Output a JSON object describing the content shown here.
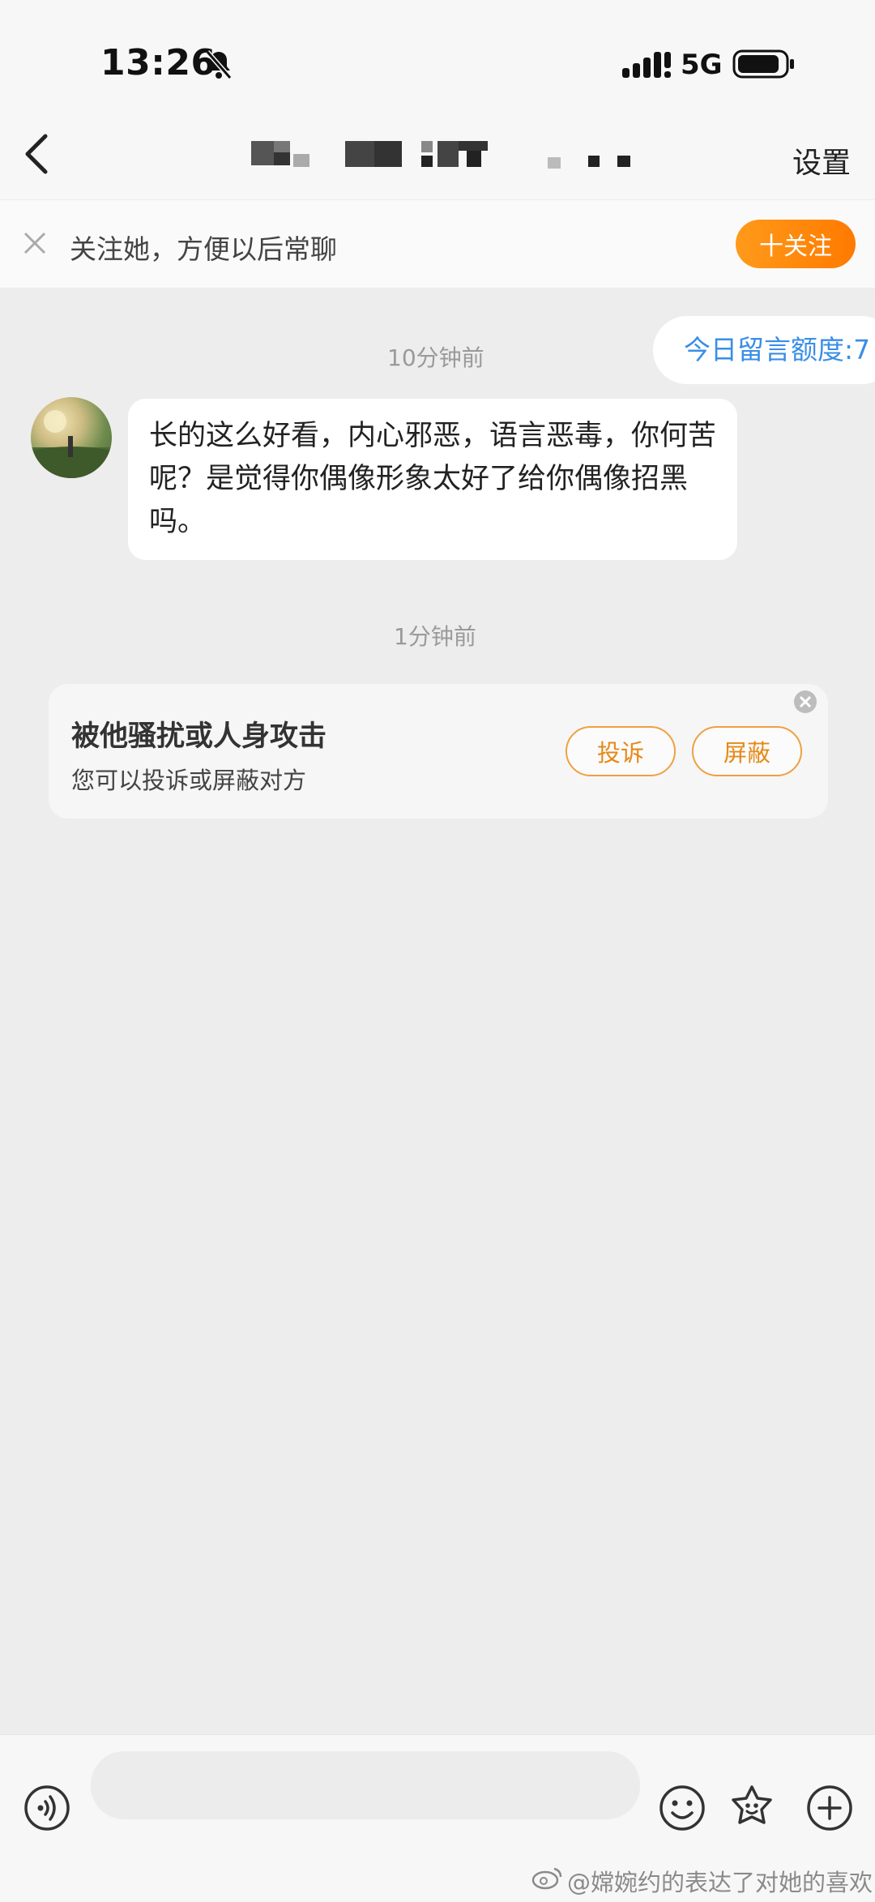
{
  "status_bar": {
    "time": "13:26",
    "network": "5G",
    "icons": [
      "bell-muted-icon",
      "signal-icon",
      "battery-icon"
    ]
  },
  "header": {
    "title": "",
    "settings_label": "设置"
  },
  "follow_banner": {
    "text": "关注她，方便以后常聊",
    "button_label": "十关注"
  },
  "chat": {
    "quota_text": "今日留言额度:7",
    "messages": [
      {
        "timestamp": "10分钟前",
        "text": "长的这么好看，内心邪恶，语言恶毒，你何苦呢？是觉得你偶像形象太好了给你偶像招黑吗。"
      }
    ],
    "second_timestamp": "1分钟前"
  },
  "harassment_card": {
    "title": "被他骚扰或人身攻击",
    "subtitle": "您可以投诉或屏蔽对方",
    "complain_label": "投诉",
    "block_label": "屏蔽"
  },
  "input_bar": {
    "placeholder": ""
  },
  "watermark": "@嫦婉约的表达了对她的喜欢",
  "colors": {
    "accent_orange": "#ff7a00",
    "link_blue": "#3a8ee6",
    "background": "#ededed"
  }
}
